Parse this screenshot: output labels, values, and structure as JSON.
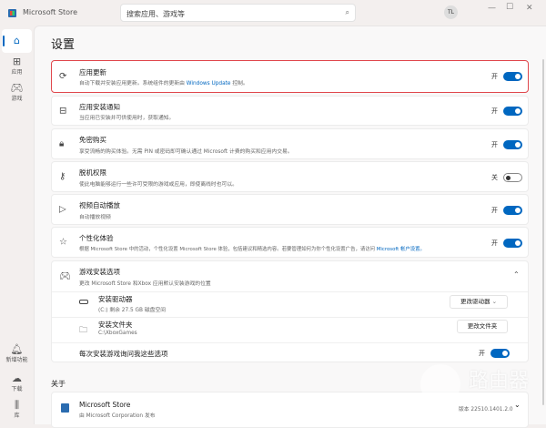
{
  "window": {
    "title": "Microsoft Store",
    "search_placeholder": "搜索应用、游戏等",
    "avatar": "TL"
  },
  "sidebar": {
    "items": [
      {
        "label": "",
        "icon": "home-icon"
      },
      {
        "label": "应用",
        "icon": "apps-icon"
      },
      {
        "label": "游戏",
        "icon": "gamepad-icon"
      },
      {
        "label": "新增功能",
        "icon": "bell-icon"
      },
      {
        "label": "下载",
        "icon": "download-icon"
      },
      {
        "label": "库",
        "icon": "library-icon"
      }
    ]
  },
  "page": {
    "title": "设置"
  },
  "on": "开",
  "off": "关",
  "settings": [
    {
      "title": "应用更新",
      "sub": "自动下载并安装应用更新。系统组件的更新由 ",
      "link": "Windows Update",
      "sub_end": " 控制。",
      "state": true
    },
    {
      "title": "应用安装通知",
      "sub": "当应用已安装并可供使用时，获取通知。",
      "state": true
    },
    {
      "title": "免密购买",
      "sub": "享受流畅的购买体验。无需 PIN 或密码即可确认通过 Microsoft 计费的购买和应用内交易。",
      "state": true
    },
    {
      "title": "脱机权限",
      "sub": "使此电脑能够运行一些许可受限的游戏或应用，即使离线时也可以。",
      "state": false
    },
    {
      "title": "视频自动播放",
      "sub": "自动播放视频",
      "state": true
    },
    {
      "title": "个性化体验",
      "sub": "根据 Microsoft Store 中的活动，个性化设置 Microsoft Store 体验，包括建议和精选内容。若要管理如何为你个性化设置广告，请访问 ",
      "link": "Microsoft 帐户设置。",
      "state": true
    }
  ],
  "game": {
    "title": "游戏安装选项",
    "sub": "更改 Microsoft Store 和Xbox 应用默认安装游戏的位置",
    "drive": {
      "title": "安装驱动器",
      "sub": "(C:) 剩余 27.5 GB 磁盘空间",
      "button": "更改驱动器"
    },
    "folder": {
      "title": "安装文件夹",
      "sub": "C:\\XboxGames",
      "button": "更改文件夹"
    },
    "ask": {
      "title": "每次安装游戏询问我这些选项",
      "state": true
    }
  },
  "about": {
    "heading": "关于",
    "app": "Microsoft Store",
    "publisher": "由 Microsoft Corporation 发布",
    "version": "版本 22510.1401.2.0"
  },
  "watermark": {
    "text": "路由器",
    "url": "luyouqi.com"
  },
  "colors": {
    "accent": "#0067c0",
    "highlight": "#e0474c"
  }
}
